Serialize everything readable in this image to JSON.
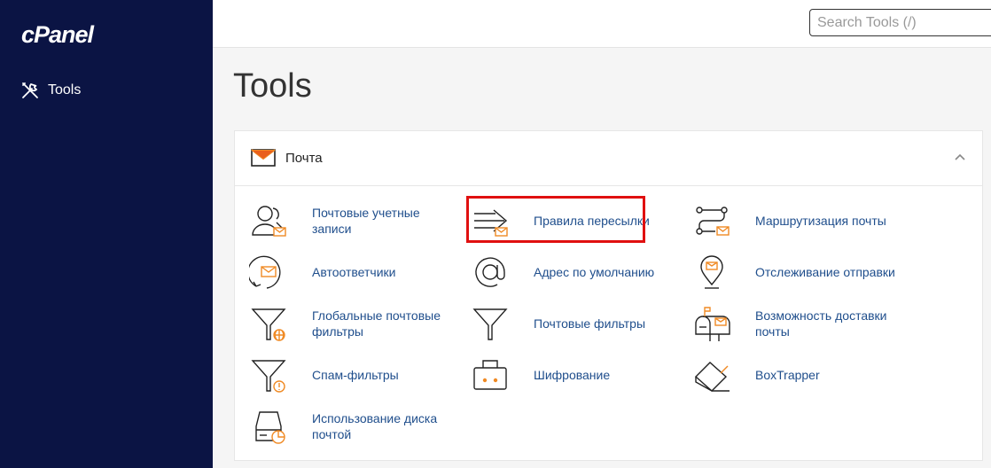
{
  "app": {
    "logo": "cPanel"
  },
  "sidebar": {
    "items": [
      {
        "label": "Tools",
        "icon": "tools-icon"
      }
    ]
  },
  "search": {
    "placeholder": "Search Tools (/)"
  },
  "page": {
    "title": "Tools"
  },
  "section": {
    "title": "Почта",
    "icon": "mail-icon",
    "collapse_icon": "chevron-up-icon",
    "tools": [
      {
        "label": "Почтовые учетные записи",
        "icon": "email-accounts-icon"
      },
      {
        "label": "Правила пересылки",
        "icon": "forwarders-icon",
        "highlighted": true
      },
      {
        "label": "Маршрутизация почты",
        "icon": "email-routing-icon"
      },
      {
        "label": "Автоответчики",
        "icon": "autoresponders-icon"
      },
      {
        "label": "Адрес по умолчанию",
        "icon": "default-address-icon"
      },
      {
        "label": "Отслеживание отправки",
        "icon": "track-delivery-icon"
      },
      {
        "label": "Глобальные почтовые фильтры",
        "icon": "global-filters-icon"
      },
      {
        "label": "Почтовые фильтры",
        "icon": "email-filters-icon"
      },
      {
        "label": "Возможность доставки почты",
        "icon": "deliverability-icon"
      },
      {
        "label": "Спам-фильтры",
        "icon": "spam-filters-icon"
      },
      {
        "label": "Шифрование",
        "icon": "encryption-icon"
      },
      {
        "label": "BoxTrapper",
        "icon": "boxtrapper-icon"
      },
      {
        "label": "Использование диска почтой",
        "icon": "disk-usage-icon"
      }
    ]
  },
  "colors": {
    "sidebar": "#0b1444",
    "accent": "#f08a24",
    "link": "#1f4e8c",
    "highlight": "#e01010"
  }
}
